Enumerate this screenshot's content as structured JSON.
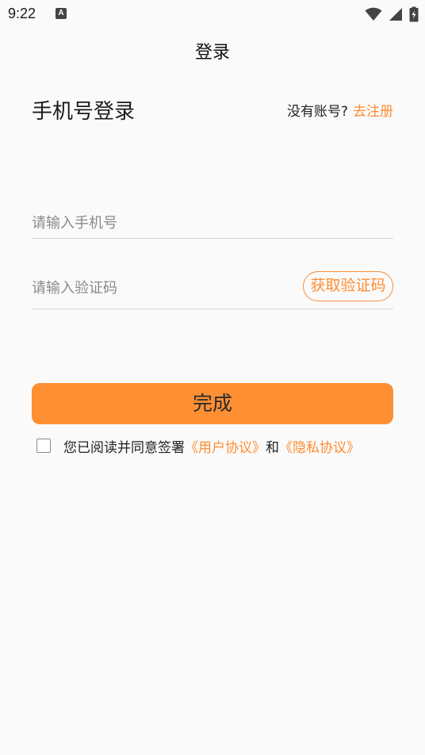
{
  "status_bar": {
    "time": "9:22",
    "app_icon_letter": "A",
    "icons": [
      "wifi-icon",
      "signal-icon",
      "battery-charging-icon"
    ]
  },
  "nav": {
    "title": "登录"
  },
  "heading": "手机号登录",
  "register": {
    "prompt": "没有账号?",
    "link": "去注册"
  },
  "phone": {
    "placeholder": "请输入手机号",
    "value": ""
  },
  "code": {
    "placeholder": "请输入验证码",
    "value": "",
    "button": "获取验证码"
  },
  "submit": {
    "label": "完成"
  },
  "agreement": {
    "checked": false,
    "prefix": "您已阅读并同意签署",
    "user_agreement": "《用户协议》",
    "conjunction": "和",
    "privacy_policy": "《隐私协议》"
  },
  "colors": {
    "accent": "#ff8c32",
    "button_bg": "#ff8f33",
    "background": "#fafafa",
    "divider": "#d6d6d6"
  }
}
